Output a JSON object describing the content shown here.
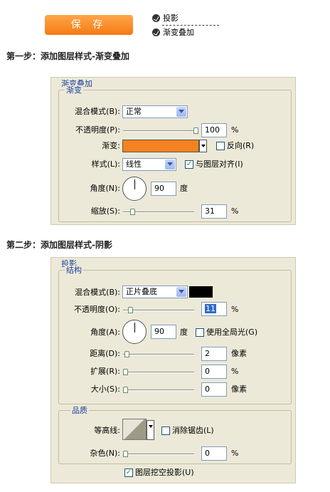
{
  "header": {
    "save_label": "保 存",
    "toc": [
      "投影",
      "渐变叠加"
    ]
  },
  "step1": {
    "title": "第一步：添加图层样式-渐变叠加",
    "panel_title": "渐变叠加",
    "group_title": "渐变",
    "blend_mode_label": "混合模式(B):",
    "blend_mode_value": "正常",
    "opacity_label": "不透明度(P):",
    "opacity_value": "100",
    "opacity_unit": "%",
    "gradient_label": "渐变:",
    "reverse_label": "反向(R)",
    "style_label": "样式(L):",
    "style_value": "线性",
    "align_label": "与图层对齐(I)",
    "angle_label": "角度(N):",
    "angle_value": "90",
    "angle_unit": "度",
    "scale_label": "缩放(S):",
    "scale_value": "31",
    "scale_unit": "%",
    "opacity_level": 1.0,
    "scale_level": 0.1,
    "gradient_color": "#f58220"
  },
  "step2": {
    "title": "第二步：添加图层样式-阴影",
    "panel_title": "投影",
    "group_title": "结构",
    "blend_mode_label": "混合模式(B):",
    "blend_mode_value": "正片叠底",
    "shadow_color": "#000000",
    "opacity_label": "不透明度(O):",
    "opacity_value": "11",
    "opacity_unit": "%",
    "angle_label": "角度(A):",
    "angle_value": "90",
    "angle_unit": "度",
    "global_light_label": "使用全局光(G)",
    "distance_label": "距离(D):",
    "distance_value": "2",
    "distance_unit": "像素",
    "spread_label": "扩展(R):",
    "spread_value": "0",
    "spread_unit": "%",
    "size_label": "大小(S):",
    "size_value": "0",
    "size_unit": "像素",
    "quality_title": "品质",
    "contour_label": "等高线:",
    "antialias_label": "消除锯齿(L)",
    "noise_label": "杂色(N):",
    "noise_value": "0",
    "noise_unit": "%",
    "knockout_label": "图层挖空投影(U)"
  }
}
